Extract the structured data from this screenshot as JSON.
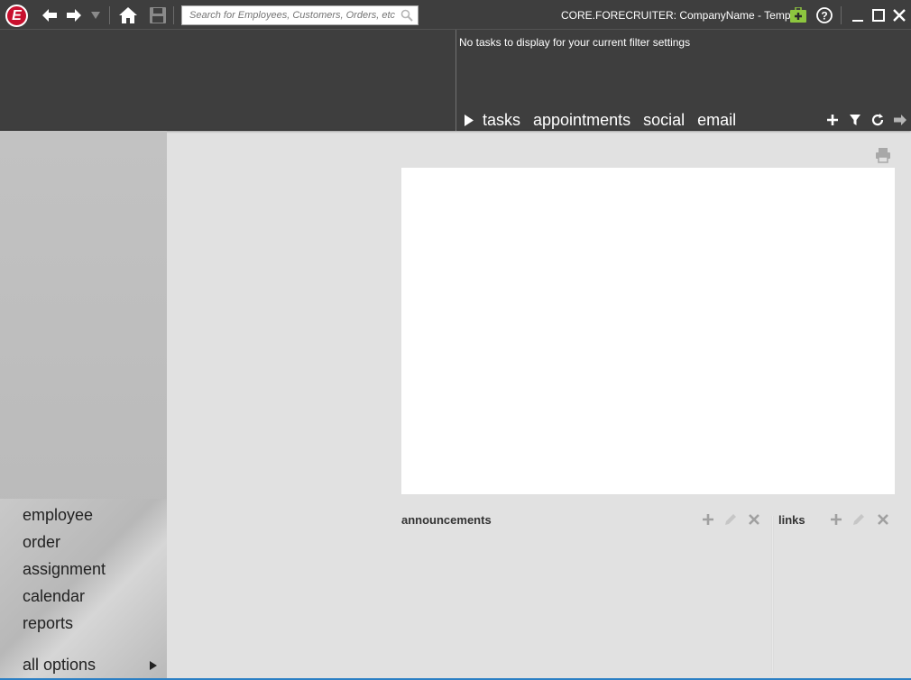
{
  "toolbar": {
    "logo_text": "E",
    "search_placeholder": "Search for Employees, Customers, Orders, etc.",
    "app_title": "CORE.FORECRUITER: CompanyName - Temp",
    "accent_color": "#8dc63f",
    "icons": [
      "back-arrow-icon",
      "forward-arrow-icon",
      "dropdown-icon",
      "home-icon",
      "save-icon",
      "search-icon",
      "new-record-icon",
      "help-icon",
      "minimize-icon",
      "maximize-icon",
      "close-icon"
    ]
  },
  "task_panel": {
    "empty_message": "No tasks to display for your current filter settings",
    "tabs": [
      "tasks",
      "appointments",
      "social",
      "email"
    ],
    "action_icons": [
      "add-icon",
      "filter-icon",
      "refresh-icon",
      "forward-icon"
    ]
  },
  "nav": {
    "items": [
      "employee",
      "order",
      "assignment",
      "calendar",
      "reports"
    ],
    "all_options": "all options"
  },
  "main": {
    "announcements": {
      "title": "announcements"
    },
    "links": {
      "title": "links"
    }
  }
}
